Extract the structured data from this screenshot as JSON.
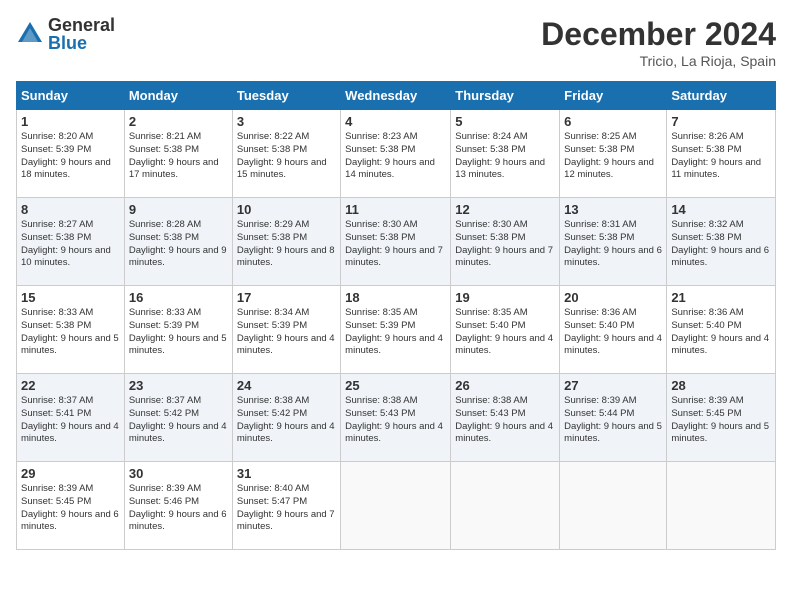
{
  "header": {
    "logo_general": "General",
    "logo_blue": "Blue",
    "month_title": "December 2024",
    "location": "Tricio, La Rioja, Spain"
  },
  "days_of_week": [
    "Sunday",
    "Monday",
    "Tuesday",
    "Wednesday",
    "Thursday",
    "Friday",
    "Saturday"
  ],
  "weeks": [
    [
      {
        "day": "1",
        "sunrise": "8:20 AM",
        "sunset": "5:39 PM",
        "daylight": "9 hours and 18 minutes."
      },
      {
        "day": "2",
        "sunrise": "8:21 AM",
        "sunset": "5:38 PM",
        "daylight": "9 hours and 17 minutes."
      },
      {
        "day": "3",
        "sunrise": "8:22 AM",
        "sunset": "5:38 PM",
        "daylight": "9 hours and 15 minutes."
      },
      {
        "day": "4",
        "sunrise": "8:23 AM",
        "sunset": "5:38 PM",
        "daylight": "9 hours and 14 minutes."
      },
      {
        "day": "5",
        "sunrise": "8:24 AM",
        "sunset": "5:38 PM",
        "daylight": "9 hours and 13 minutes."
      },
      {
        "day": "6",
        "sunrise": "8:25 AM",
        "sunset": "5:38 PM",
        "daylight": "9 hours and 12 minutes."
      },
      {
        "day": "7",
        "sunrise": "8:26 AM",
        "sunset": "5:38 PM",
        "daylight": "9 hours and 11 minutes."
      }
    ],
    [
      {
        "day": "8",
        "sunrise": "8:27 AM",
        "sunset": "5:38 PM",
        "daylight": "9 hours and 10 minutes."
      },
      {
        "day": "9",
        "sunrise": "8:28 AM",
        "sunset": "5:38 PM",
        "daylight": "9 hours and 9 minutes."
      },
      {
        "day": "10",
        "sunrise": "8:29 AM",
        "sunset": "5:38 PM",
        "daylight": "9 hours and 8 minutes."
      },
      {
        "day": "11",
        "sunrise": "8:30 AM",
        "sunset": "5:38 PM",
        "daylight": "9 hours and 7 minutes."
      },
      {
        "day": "12",
        "sunrise": "8:30 AM",
        "sunset": "5:38 PM",
        "daylight": "9 hours and 7 minutes."
      },
      {
        "day": "13",
        "sunrise": "8:31 AM",
        "sunset": "5:38 PM",
        "daylight": "9 hours and 6 minutes."
      },
      {
        "day": "14",
        "sunrise": "8:32 AM",
        "sunset": "5:38 PM",
        "daylight": "9 hours and 6 minutes."
      }
    ],
    [
      {
        "day": "15",
        "sunrise": "8:33 AM",
        "sunset": "5:38 PM",
        "daylight": "9 hours and 5 minutes."
      },
      {
        "day": "16",
        "sunrise": "8:33 AM",
        "sunset": "5:39 PM",
        "daylight": "9 hours and 5 minutes."
      },
      {
        "day": "17",
        "sunrise": "8:34 AM",
        "sunset": "5:39 PM",
        "daylight": "9 hours and 4 minutes."
      },
      {
        "day": "18",
        "sunrise": "8:35 AM",
        "sunset": "5:39 PM",
        "daylight": "9 hours and 4 minutes."
      },
      {
        "day": "19",
        "sunrise": "8:35 AM",
        "sunset": "5:40 PM",
        "daylight": "9 hours and 4 minutes."
      },
      {
        "day": "20",
        "sunrise": "8:36 AM",
        "sunset": "5:40 PM",
        "daylight": "9 hours and 4 minutes."
      },
      {
        "day": "21",
        "sunrise": "8:36 AM",
        "sunset": "5:40 PM",
        "daylight": "9 hours and 4 minutes."
      }
    ],
    [
      {
        "day": "22",
        "sunrise": "8:37 AM",
        "sunset": "5:41 PM",
        "daylight": "9 hours and 4 minutes."
      },
      {
        "day": "23",
        "sunrise": "8:37 AM",
        "sunset": "5:42 PM",
        "daylight": "9 hours and 4 minutes."
      },
      {
        "day": "24",
        "sunrise": "8:38 AM",
        "sunset": "5:42 PM",
        "daylight": "9 hours and 4 minutes."
      },
      {
        "day": "25",
        "sunrise": "8:38 AM",
        "sunset": "5:43 PM",
        "daylight": "9 hours and 4 minutes."
      },
      {
        "day": "26",
        "sunrise": "8:38 AM",
        "sunset": "5:43 PM",
        "daylight": "9 hours and 4 minutes."
      },
      {
        "day": "27",
        "sunrise": "8:39 AM",
        "sunset": "5:44 PM",
        "daylight": "9 hours and 5 minutes."
      },
      {
        "day": "28",
        "sunrise": "8:39 AM",
        "sunset": "5:45 PM",
        "daylight": "9 hours and 5 minutes."
      }
    ],
    [
      {
        "day": "29",
        "sunrise": "8:39 AM",
        "sunset": "5:45 PM",
        "daylight": "9 hours and 6 minutes."
      },
      {
        "day": "30",
        "sunrise": "8:39 AM",
        "sunset": "5:46 PM",
        "daylight": "9 hours and 6 minutes."
      },
      {
        "day": "31",
        "sunrise": "8:40 AM",
        "sunset": "5:47 PM",
        "daylight": "9 hours and 7 minutes."
      },
      null,
      null,
      null,
      null
    ]
  ],
  "labels": {
    "sunrise": "Sunrise:",
    "sunset": "Sunset:",
    "daylight": "Daylight:"
  }
}
